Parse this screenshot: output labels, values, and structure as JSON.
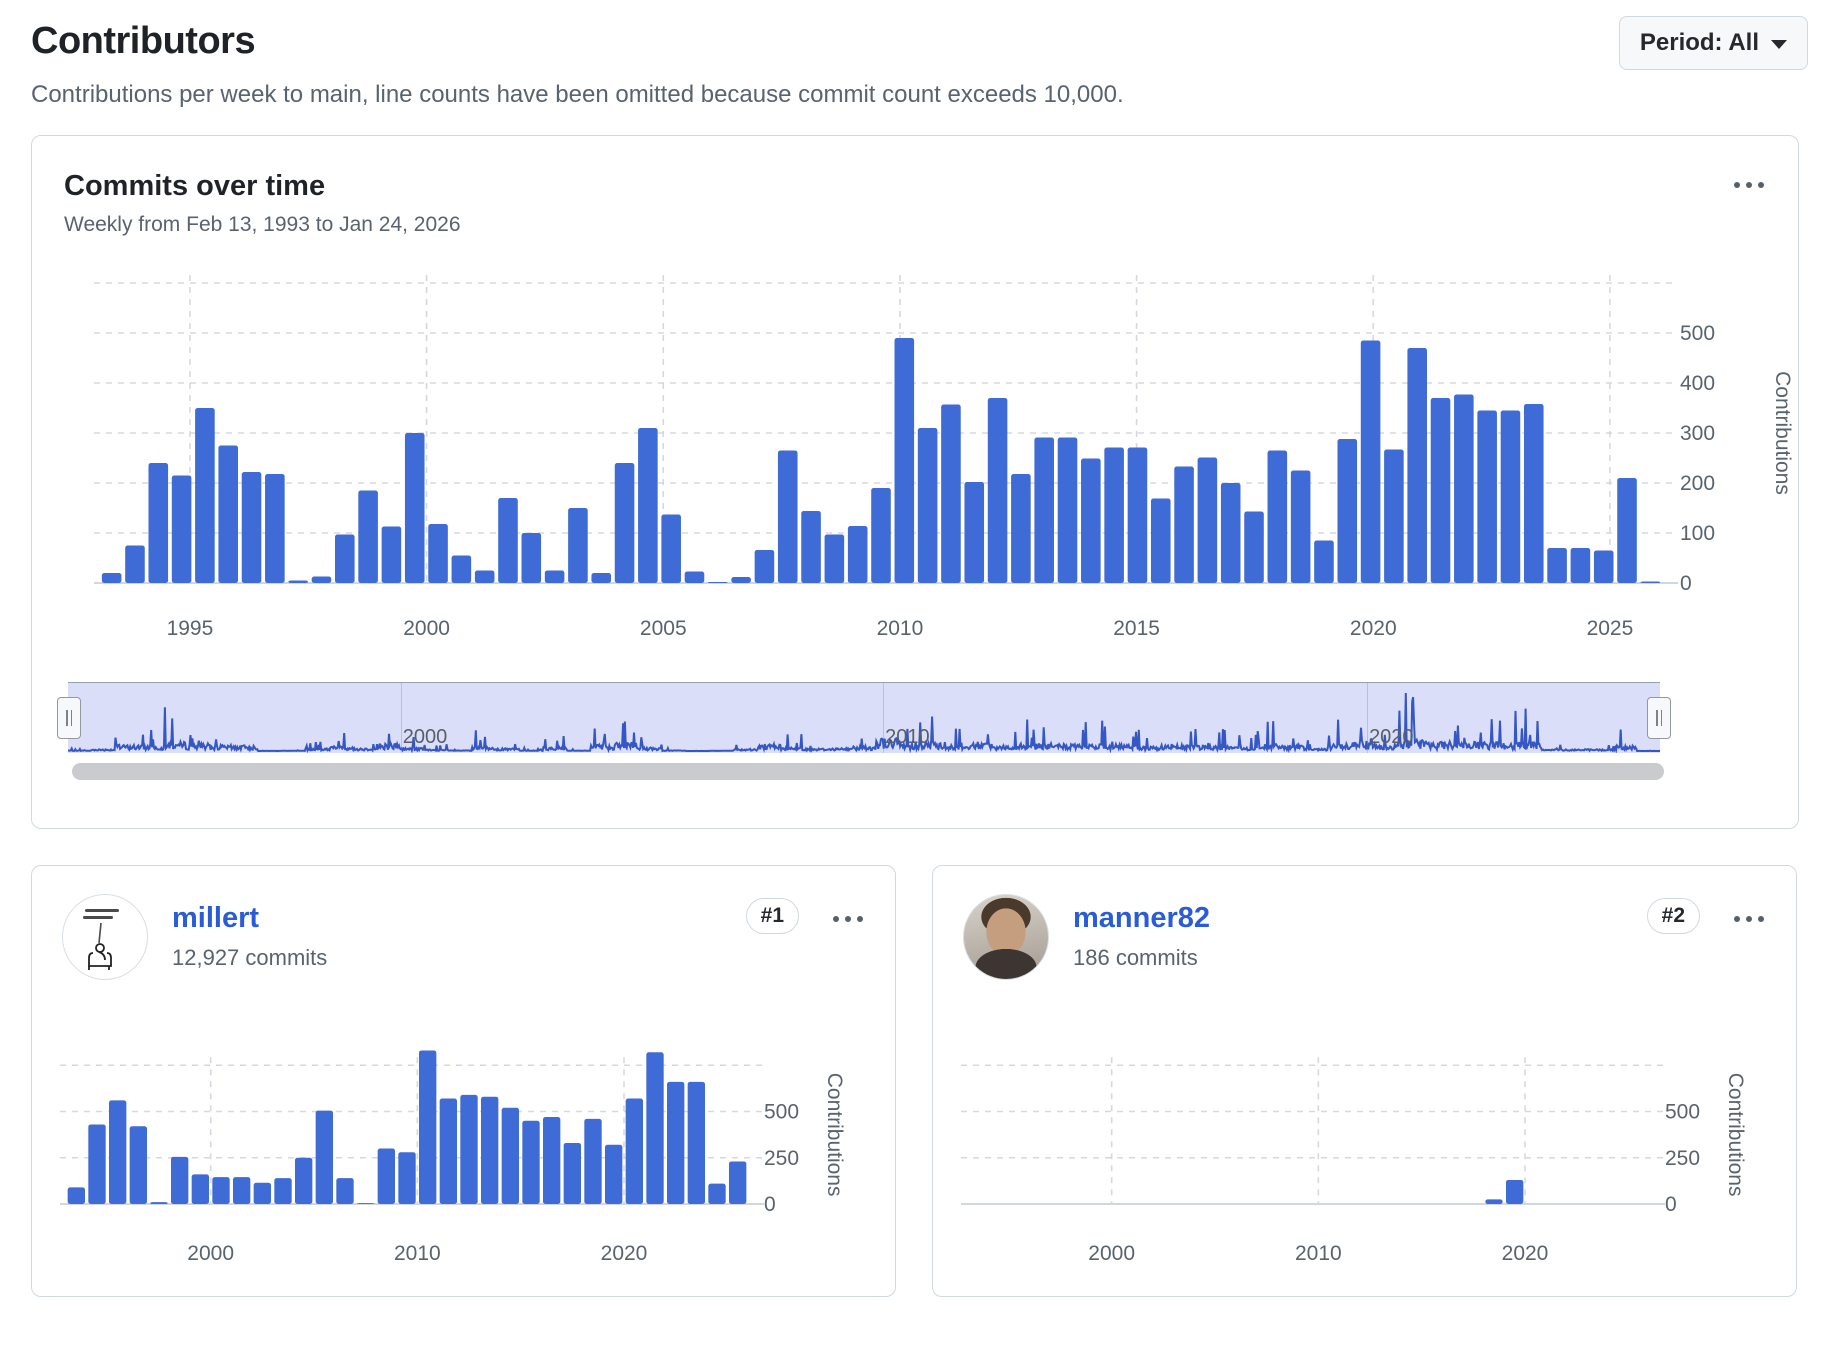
{
  "page": {
    "title": "Contributors",
    "subtitle": "Contributions per week to main, line counts have been omitted because commit count exceeds 10,000.",
    "period_button": {
      "label": "Period: All",
      "caret_icon": "triangle-down"
    }
  },
  "colors": {
    "bar": "#3e6bd5",
    "accent_link": "#2a5cd5",
    "grid": "#ced3da",
    "axis_text": "#59636e",
    "border": "#d1d9e0",
    "brush_fill": "#dbdef9",
    "brush_line": "#3457c4",
    "scrollbar": "#c9cbce",
    "text": "#1f2328",
    "muted": "#59636e",
    "button_bg": "#f6f8fa"
  },
  "main_card": {
    "title": "Commits over time",
    "subtitle": "Weekly from Feb 13, 1993 to Jan 24, 2026",
    "menu_icon": "kebab-horizontal-icon",
    "chart_data": {
      "type": "bar",
      "title": "Commits over time",
      "x_start": 1993.1,
      "x_step": 0.5,
      "x_end": 2026.1,
      "values": [
        20,
        75,
        240,
        215,
        350,
        275,
        222,
        218,
        5,
        13,
        97,
        185,
        113,
        300,
        118,
        55,
        25,
        170,
        100,
        25,
        150,
        20,
        240,
        310,
        137,
        23,
        2,
        12,
        66,
        265,
        144,
        97,
        114,
        190,
        490,
        310,
        357,
        202,
        370,
        218,
        291,
        291,
        249,
        271,
        271,
        169,
        233,
        251,
        200,
        143,
        265,
        225,
        85,
        288,
        485,
        267,
        470,
        370,
        377,
        345,
        345,
        358,
        70,
        70,
        65,
        210,
        3
      ],
      "xticks": [
        1995,
        2000,
        2005,
        2010,
        2015,
        2020,
        2025
      ],
      "yticks": [
        0,
        100,
        200,
        300,
        400,
        500
      ],
      "ylim": [
        0,
        600
      ],
      "ylabel": "Contributions",
      "grid": true,
      "legend": "none"
    },
    "brush": {
      "type": "line-minimap",
      "represents": "weekly commit totals for full range Feb 13, 1993 - Jan 24, 2026",
      "labels": [
        "2000",
        "2010",
        "2020"
      ],
      "label_years": [
        2000,
        2010,
        2020
      ],
      "handle_icon": "grip-handle",
      "selection": "all"
    }
  },
  "contributors": [
    {
      "username": "millert",
      "commits_label": "12,927 commits",
      "rank": "#1",
      "avatar_kind": "comic-drawing",
      "menu_icon": "kebab-horizontal-icon",
      "chart_data": {
        "type": "bar",
        "x_start": 1993,
        "x_step": 1,
        "x_end": 2026,
        "values": [
          90,
          430,
          560,
          420,
          10,
          255,
          160,
          145,
          145,
          115,
          140,
          250,
          505,
          140,
          5,
          300,
          280,
          830,
          570,
          590,
          580,
          520,
          450,
          470,
          330,
          460,
          320,
          570,
          820,
          660,
          660,
          110,
          230
        ],
        "xticks": [
          2000,
          2010,
          2020
        ],
        "yticks": [
          0,
          250,
          500
        ],
        "ylim": [
          0,
          900
        ],
        "ylabel": "Contributions",
        "grid": true
      }
    },
    {
      "username": "manner82",
      "commits_label": "186 commits",
      "rank": "#2",
      "avatar_kind": "photo",
      "menu_icon": "kebab-horizontal-icon",
      "chart_data": {
        "type": "bar",
        "x_start": 1993,
        "x_step": 1,
        "x_end": 2026,
        "values": [
          0,
          0,
          0,
          0,
          0,
          0,
          0,
          0,
          0,
          0,
          0,
          0,
          0,
          0,
          0,
          0,
          0,
          0,
          0,
          0,
          0,
          0,
          0,
          0,
          0,
          25,
          130,
          0,
          0,
          0,
          0,
          0,
          0
        ],
        "xticks": [
          2000,
          2010,
          2020
        ],
        "yticks": [
          0,
          250,
          500
        ],
        "ylim": [
          0,
          900
        ],
        "ylabel": "Contributions",
        "grid": true
      }
    }
  ]
}
